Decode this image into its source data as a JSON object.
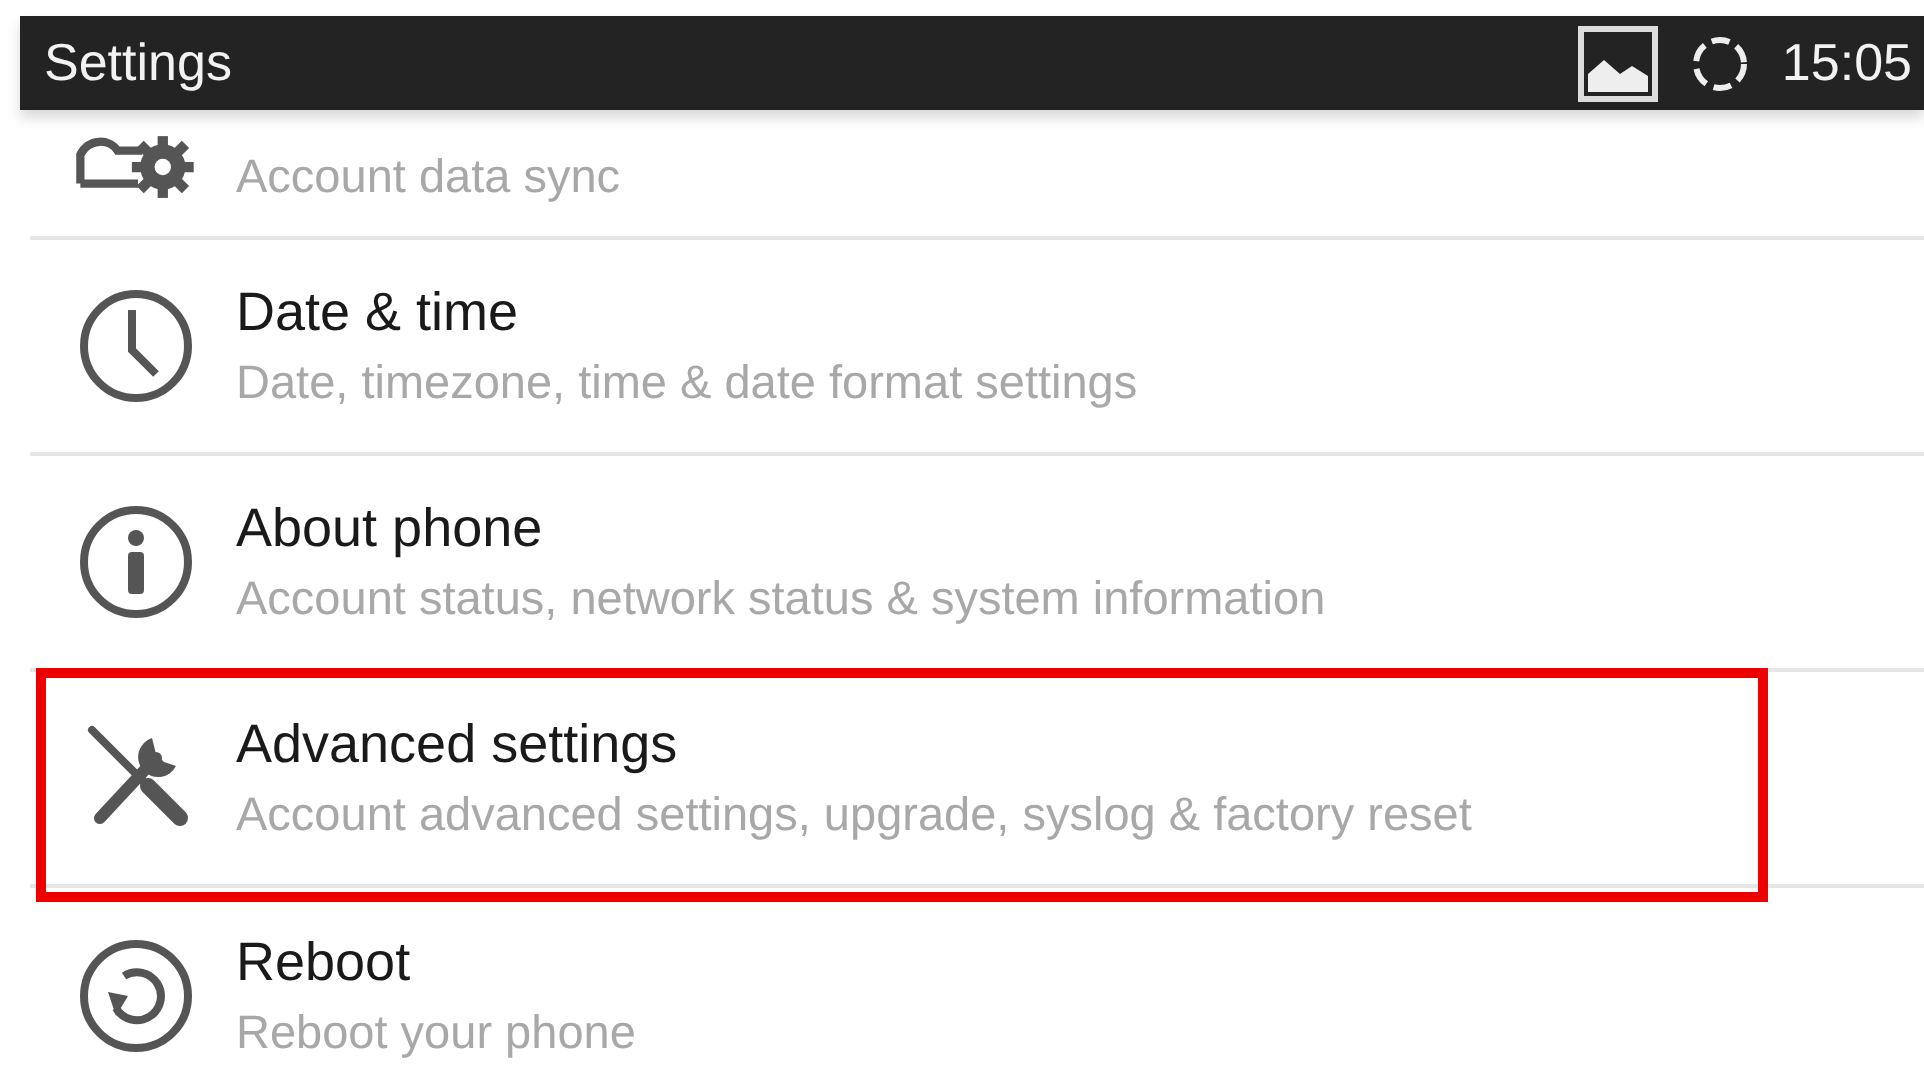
{
  "status_bar": {
    "title": "Settings",
    "time": "15:05"
  },
  "items": [
    {
      "kind": "accounts",
      "subtitle": "Account data sync",
      "highlighted": false
    },
    {
      "kind": "clock",
      "title": "Date & time",
      "subtitle": "Date, timezone, time & date format settings",
      "highlighted": false
    },
    {
      "kind": "info",
      "title": "About phone",
      "subtitle": "Account status, network status & system information",
      "highlighted": false
    },
    {
      "kind": "tools",
      "title": "Advanced settings",
      "subtitle": "Account advanced settings, upgrade, syslog & factory reset",
      "highlighted": true
    },
    {
      "kind": "reboot",
      "title": "Reboot",
      "subtitle": "Reboot your phone",
      "highlighted": false
    }
  ]
}
